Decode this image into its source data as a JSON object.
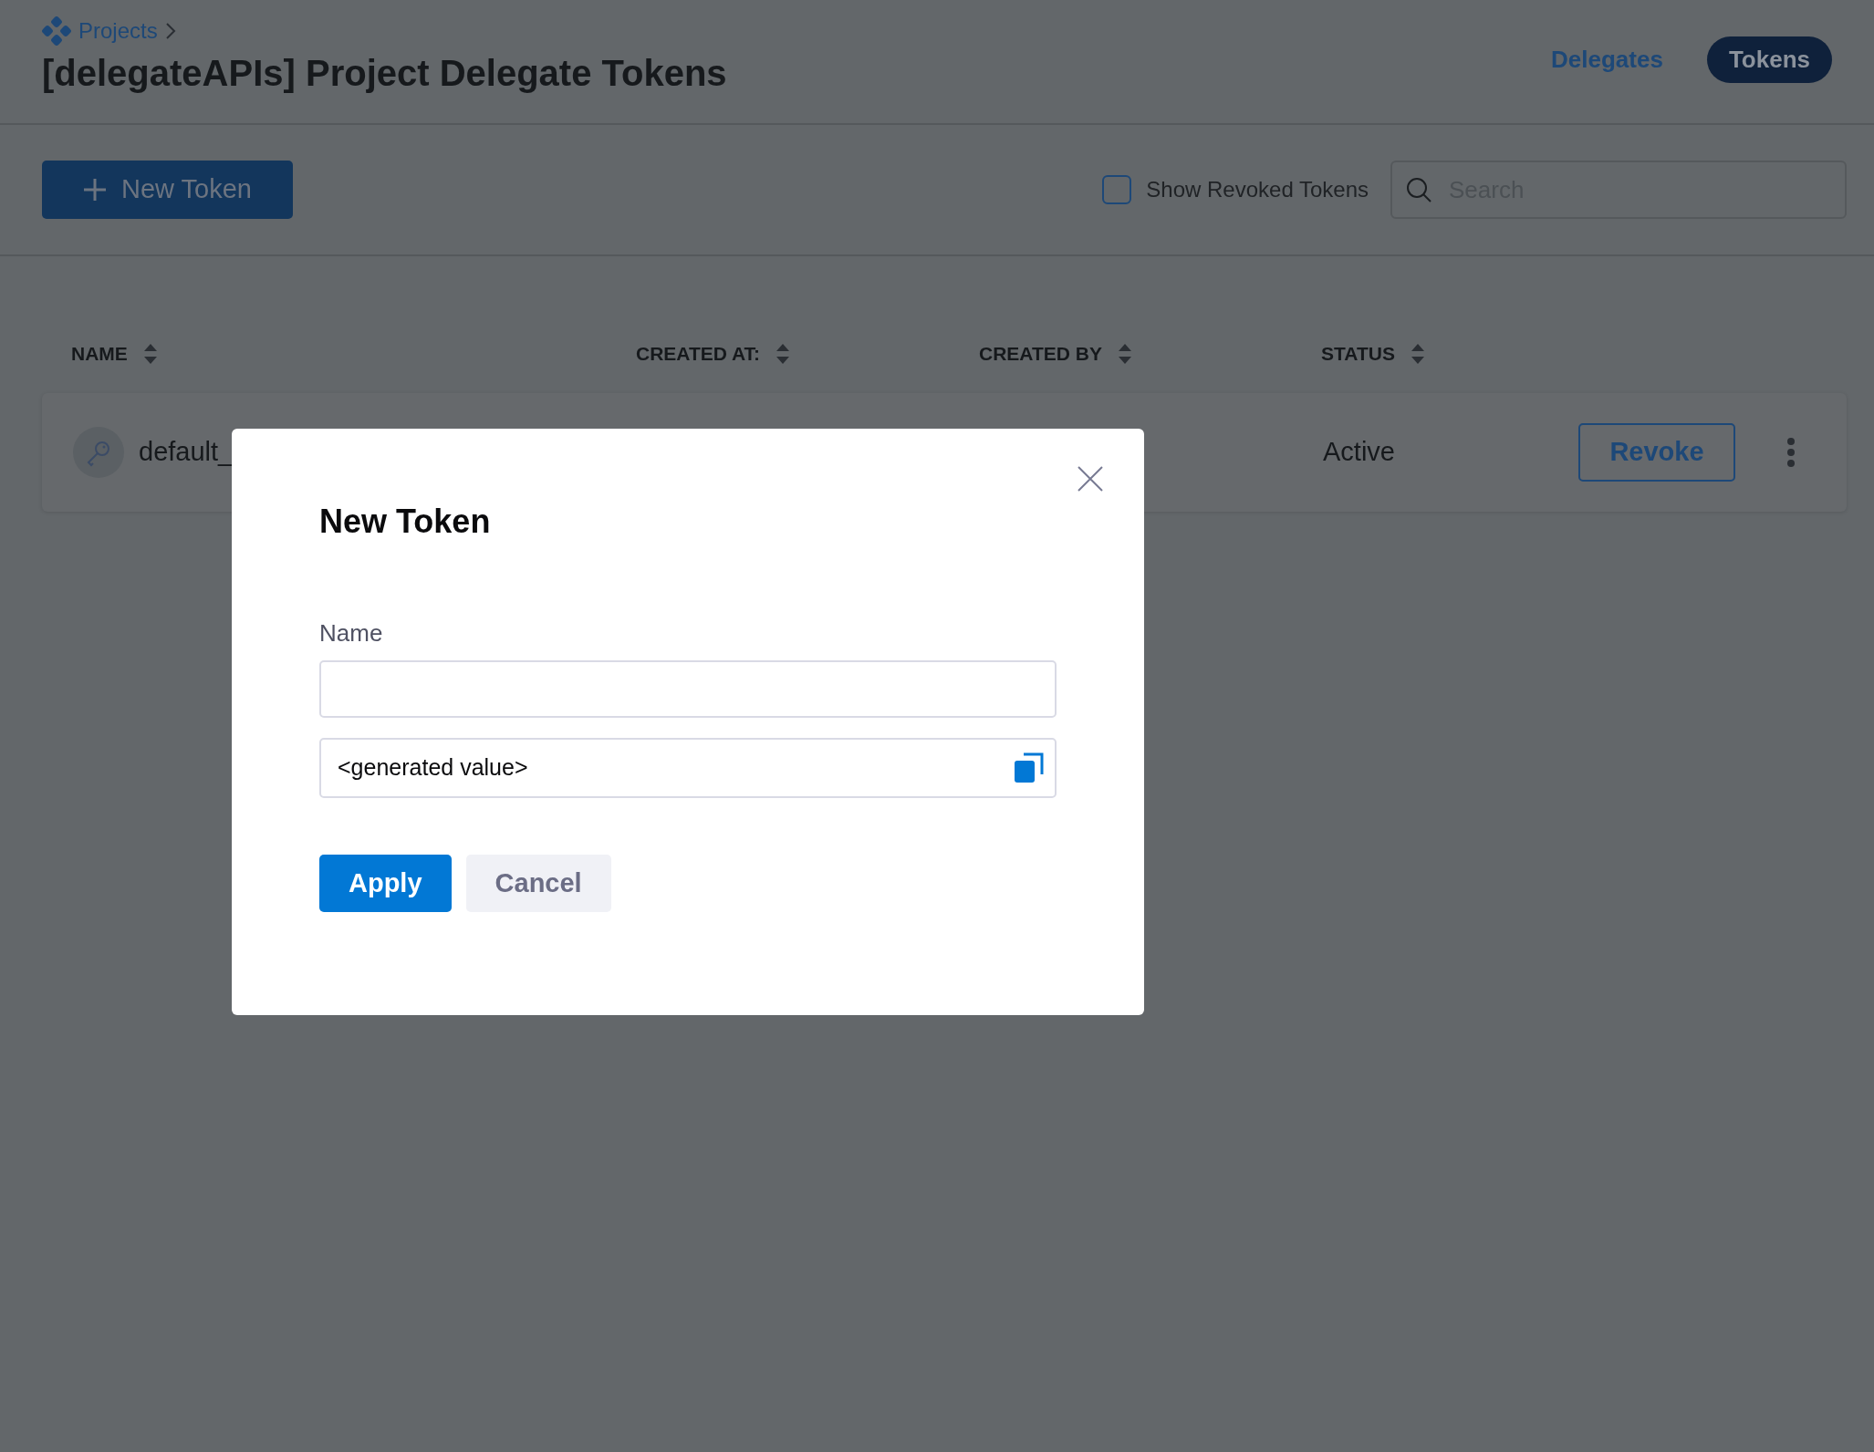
{
  "breadcrumb": {
    "label": "Projects"
  },
  "title": "[delegateAPIs] Project Delegate Tokens",
  "tabs": [
    {
      "label": "Delegates",
      "selected": false
    },
    {
      "label": "Tokens",
      "selected": true
    }
  ],
  "toolbar": {
    "new_button": "New Token",
    "show_revoked": {
      "label": "Show Revoked Tokens",
      "checked": false
    },
    "search": {
      "placeholder": "Search"
    }
  },
  "table": {
    "columns": [
      "NAME",
      "CREATED AT:",
      "CREATED BY",
      "STATUS"
    ],
    "rows": [
      {
        "name": "default_",
        "status": "Active",
        "action": "Revoke"
      }
    ]
  },
  "dialog": {
    "title": "New Token",
    "name_field": {
      "label": "Name"
    },
    "token_field": {
      "value": "<generated value>"
    },
    "buttons": [
      {
        "label": "Apply",
        "kind": "primary"
      },
      {
        "label": "Cancel",
        "kind": "secondary"
      }
    ]
  }
}
